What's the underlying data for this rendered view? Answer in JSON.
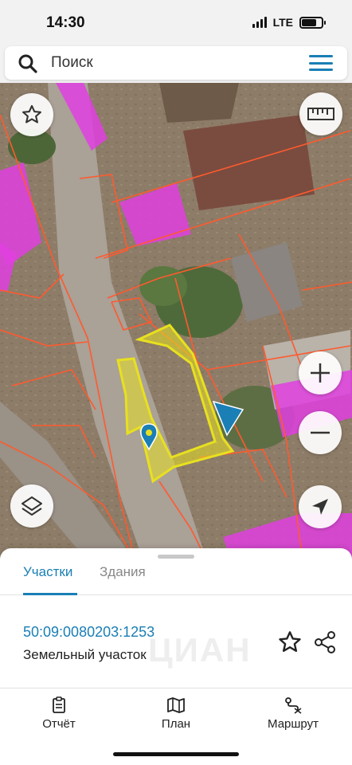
{
  "status": {
    "time": "14:30",
    "network": "LTE"
  },
  "search": {
    "placeholder": "Поиск"
  },
  "map": {
    "parcel_highlight_color": "#e8e020",
    "boundary_color": "#ff5a2e",
    "building_color": "#e040e0",
    "buttons": [
      "star-icon",
      "ruler-icon",
      "layers-icon",
      "zoom-in-icon",
      "zoom-out-icon",
      "locate-icon"
    ]
  },
  "sheet": {
    "tabs": [
      {
        "label": "Участки",
        "active": true
      },
      {
        "label": "Здания",
        "active": false
      }
    ],
    "parcel": {
      "cadastral_number": "50:09:0080203:1253",
      "type": "Земельный участок"
    },
    "watermark": "ЦИАН"
  },
  "nav": [
    {
      "label": "Отчёт",
      "icon": "report-icon"
    },
    {
      "label": "План",
      "icon": "map-plan-icon"
    },
    {
      "label": "Маршрут",
      "icon": "route-icon"
    }
  ],
  "colors": {
    "accent": "#1a7fb5"
  }
}
